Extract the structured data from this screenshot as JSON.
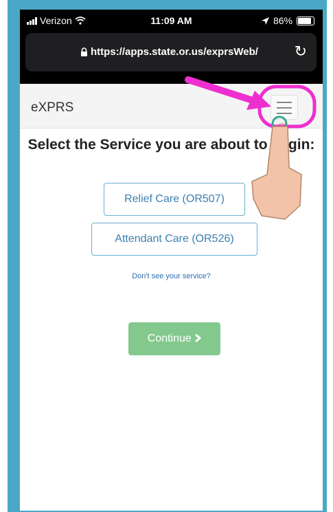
{
  "status_bar": {
    "carrier": "Verizon",
    "time": "11:09 AM",
    "battery": "86%"
  },
  "browser": {
    "url": "https://apps.state.or.us/exprsWeb/"
  },
  "navbar": {
    "brand": "eXPRS"
  },
  "main": {
    "title": "Select the Service you are about to begin:",
    "services": [
      "Relief Care (OR507)",
      "Attendant Care (OR526)"
    ],
    "help_link": "Don't see your service?",
    "continue_label": "Continue"
  },
  "icons": {
    "signal": "signal-bars-icon",
    "wifi": "wifi-icon",
    "location": "location-arrow-icon",
    "battery": "battery-icon",
    "lock": "lock-icon",
    "reload": "reload-icon",
    "menu": "hamburger-menu-icon",
    "continue": "chevron-right-icon"
  },
  "colors": {
    "frame": "#4aa8c6",
    "annotation": "#ee2fd0",
    "link": "#2a6db0",
    "continue_button": "#83c98e"
  }
}
